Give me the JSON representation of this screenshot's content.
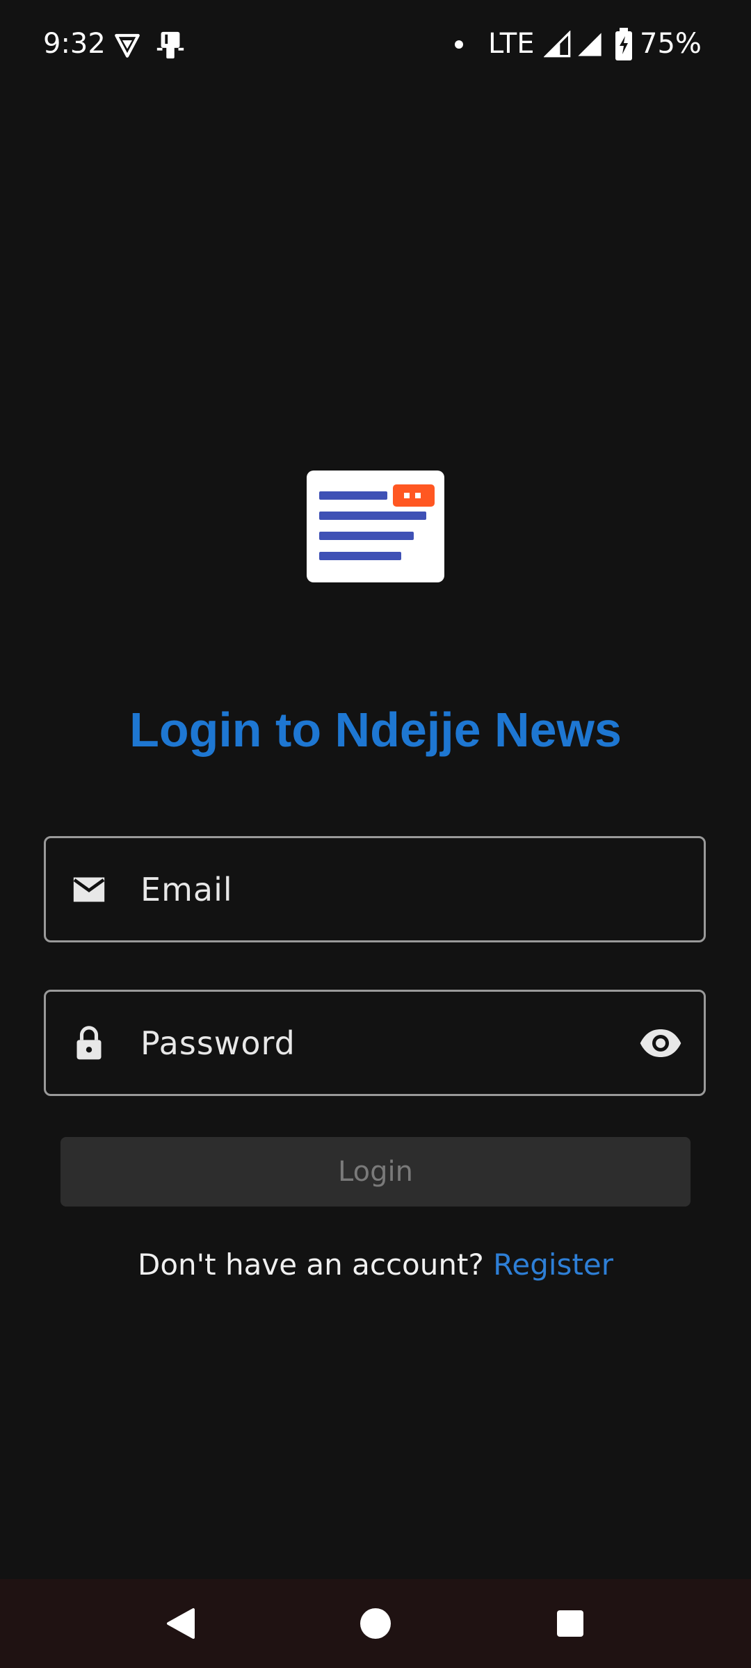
{
  "status_bar": {
    "time": "9:32",
    "network": "LTE",
    "battery": "75%",
    "icons": [
      "vpn-shield-icon",
      "device-icon",
      "notification-dot-icon",
      "signal-icon",
      "signal-icon",
      "battery-charging-icon"
    ]
  },
  "logo": {
    "icon": "news-document-icon",
    "colors": {
      "card": "#ffffff",
      "lines": "#3f51b5",
      "badge": "#ff5722"
    }
  },
  "title": "Login to Ndejje News",
  "form": {
    "email": {
      "placeholder": "Email",
      "icon": "mail-icon"
    },
    "password": {
      "placeholder": "Password",
      "icon": "lock-icon",
      "toggle_icon": "eye-icon"
    },
    "login_label": "Login"
  },
  "register": {
    "prompt": "Don't have an account?",
    "link": "Register"
  },
  "nav": {
    "back_icon": "back-triangle-icon",
    "home_icon": "home-circle-icon",
    "recents_icon": "recents-square-icon"
  },
  "colors": {
    "background": "#121212",
    "accent": "#1e77d2",
    "field_border": "#9a9a9a",
    "button_disabled": "#2d2d2d"
  }
}
